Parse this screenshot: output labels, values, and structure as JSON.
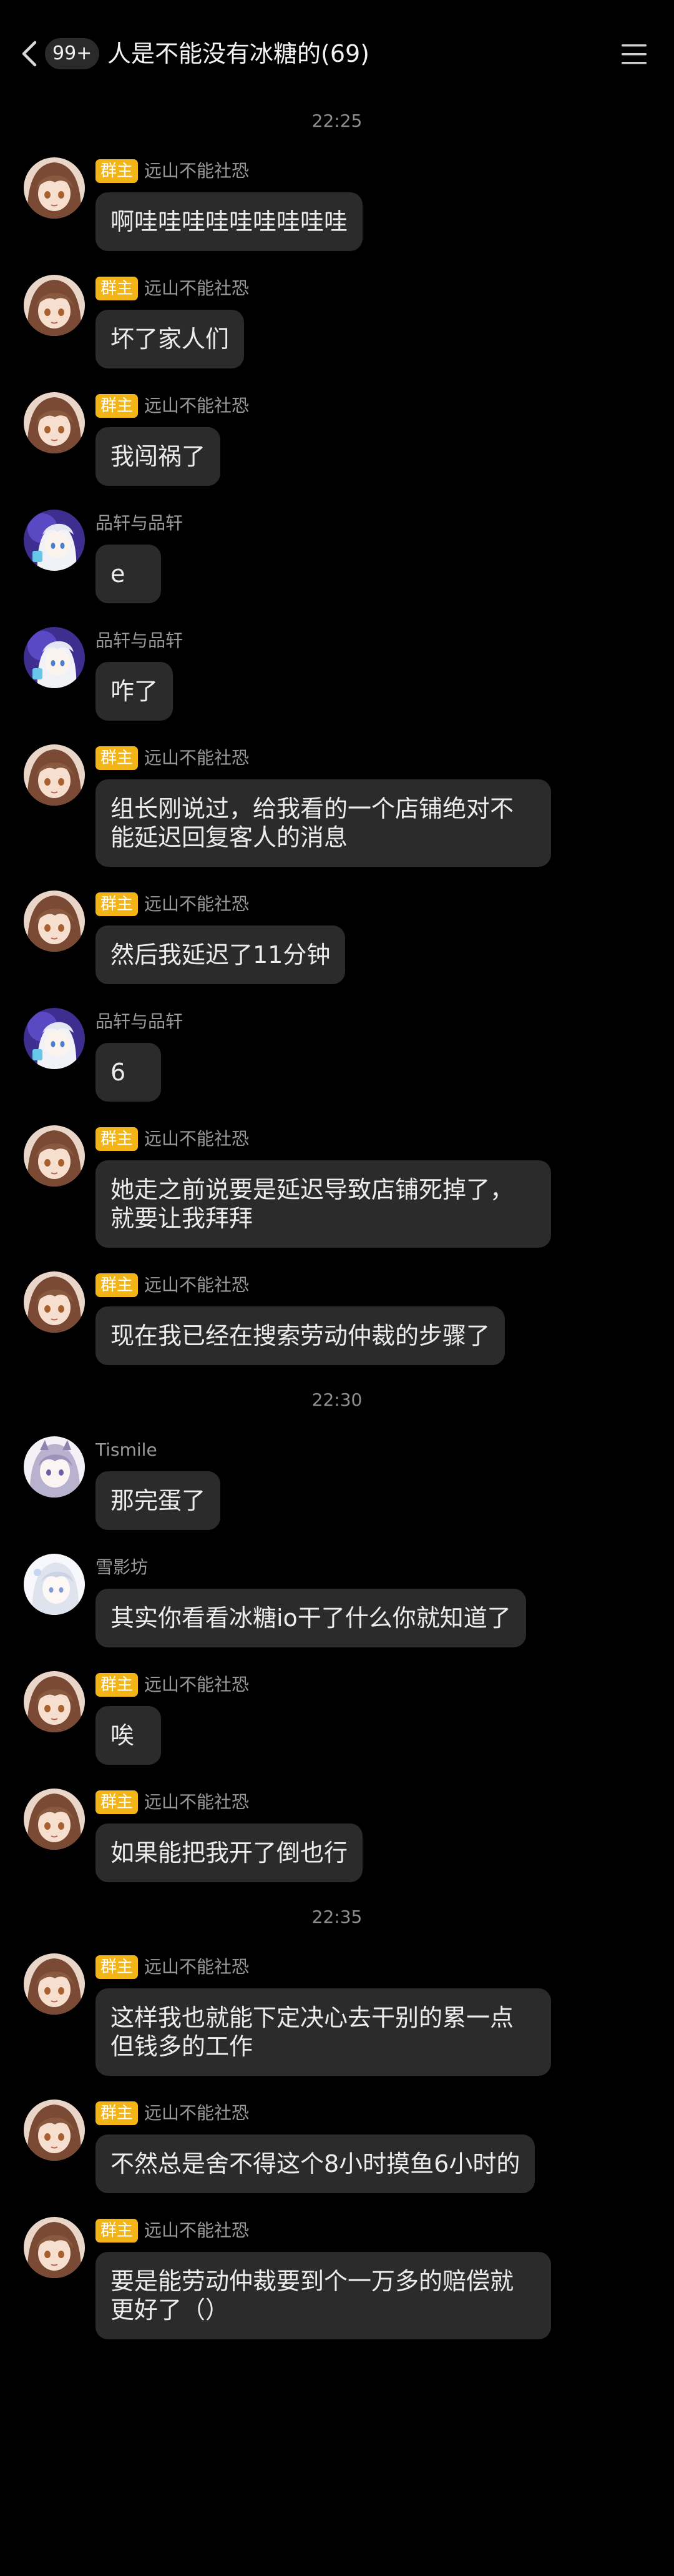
{
  "header": {
    "unread_badge": "99+",
    "title": "人是不能没有冰糖的(69)"
  },
  "timestamps": [
    "22:25",
    "22:30",
    "22:35"
  ],
  "labels": {
    "owner_tag": "群主"
  },
  "messages": [
    {
      "sender": "远山不能社恐",
      "owner": true,
      "avatar": "avatar-yuanshan",
      "text": "啊哇哇哇哇哇哇哇哇哇"
    },
    {
      "sender": "远山不能社恐",
      "owner": true,
      "avatar": "avatar-yuanshan",
      "text": "坏了家人们"
    },
    {
      "sender": "远山不能社恐",
      "owner": true,
      "avatar": "avatar-yuanshan",
      "text": "我闯祸了"
    },
    {
      "sender": "品轩与品轩",
      "owner": false,
      "avatar": "avatar-pinxuan",
      "text": "e"
    },
    {
      "sender": "品轩与品轩",
      "owner": false,
      "avatar": "avatar-pinxuan",
      "text": "咋了"
    },
    {
      "sender": "远山不能社恐",
      "owner": true,
      "avatar": "avatar-yuanshan",
      "text": "组长刚说过，给我看的一个店铺绝对不能延迟回复客人的消息"
    },
    {
      "sender": "远山不能社恐",
      "owner": true,
      "avatar": "avatar-yuanshan",
      "text": "然后我延迟了11分钟"
    },
    {
      "sender": "品轩与品轩",
      "owner": false,
      "avatar": "avatar-pinxuan",
      "text": "6"
    },
    {
      "sender": "远山不能社恐",
      "owner": true,
      "avatar": "avatar-yuanshan",
      "text": "她走之前说要是延迟导致店铺死掉了，就要让我拜拜"
    },
    {
      "sender": "远山不能社恐",
      "owner": true,
      "avatar": "avatar-yuanshan",
      "text": "现在我已经在搜索劳动仲裁的步骤了"
    },
    {
      "sender": "Tismile",
      "owner": false,
      "avatar": "avatar-tismile",
      "text": "那完蛋了"
    },
    {
      "sender": "雪影坊",
      "owner": false,
      "avatar": "avatar-xueying",
      "text": "其实你看看冰糖io干了什么你就知道了"
    },
    {
      "sender": "远山不能社恐",
      "owner": true,
      "avatar": "avatar-yuanshan",
      "text": "唉"
    },
    {
      "sender": "远山不能社恐",
      "owner": true,
      "avatar": "avatar-yuanshan",
      "text": "如果能把我开了倒也行"
    },
    {
      "sender": "远山不能社恐",
      "owner": true,
      "avatar": "avatar-yuanshan",
      "text": "这样我也就能下定决心去干别的累一点但钱多的工作"
    },
    {
      "sender": "远山不能社恐",
      "owner": true,
      "avatar": "avatar-yuanshan",
      "text": "不然总是舍不得这个8小时摸鱼6小时的"
    },
    {
      "sender": "远山不能社恐",
      "owner": true,
      "avatar": "avatar-yuanshan",
      "text": "要是能劳动仲裁要到个一万多的赔偿就更好了（）"
    }
  ],
  "colors": {
    "background": "#000000",
    "bubble": "#2b2b2b",
    "owner_tag": "#f2b416",
    "meta_text": "#9a9a9a"
  }
}
